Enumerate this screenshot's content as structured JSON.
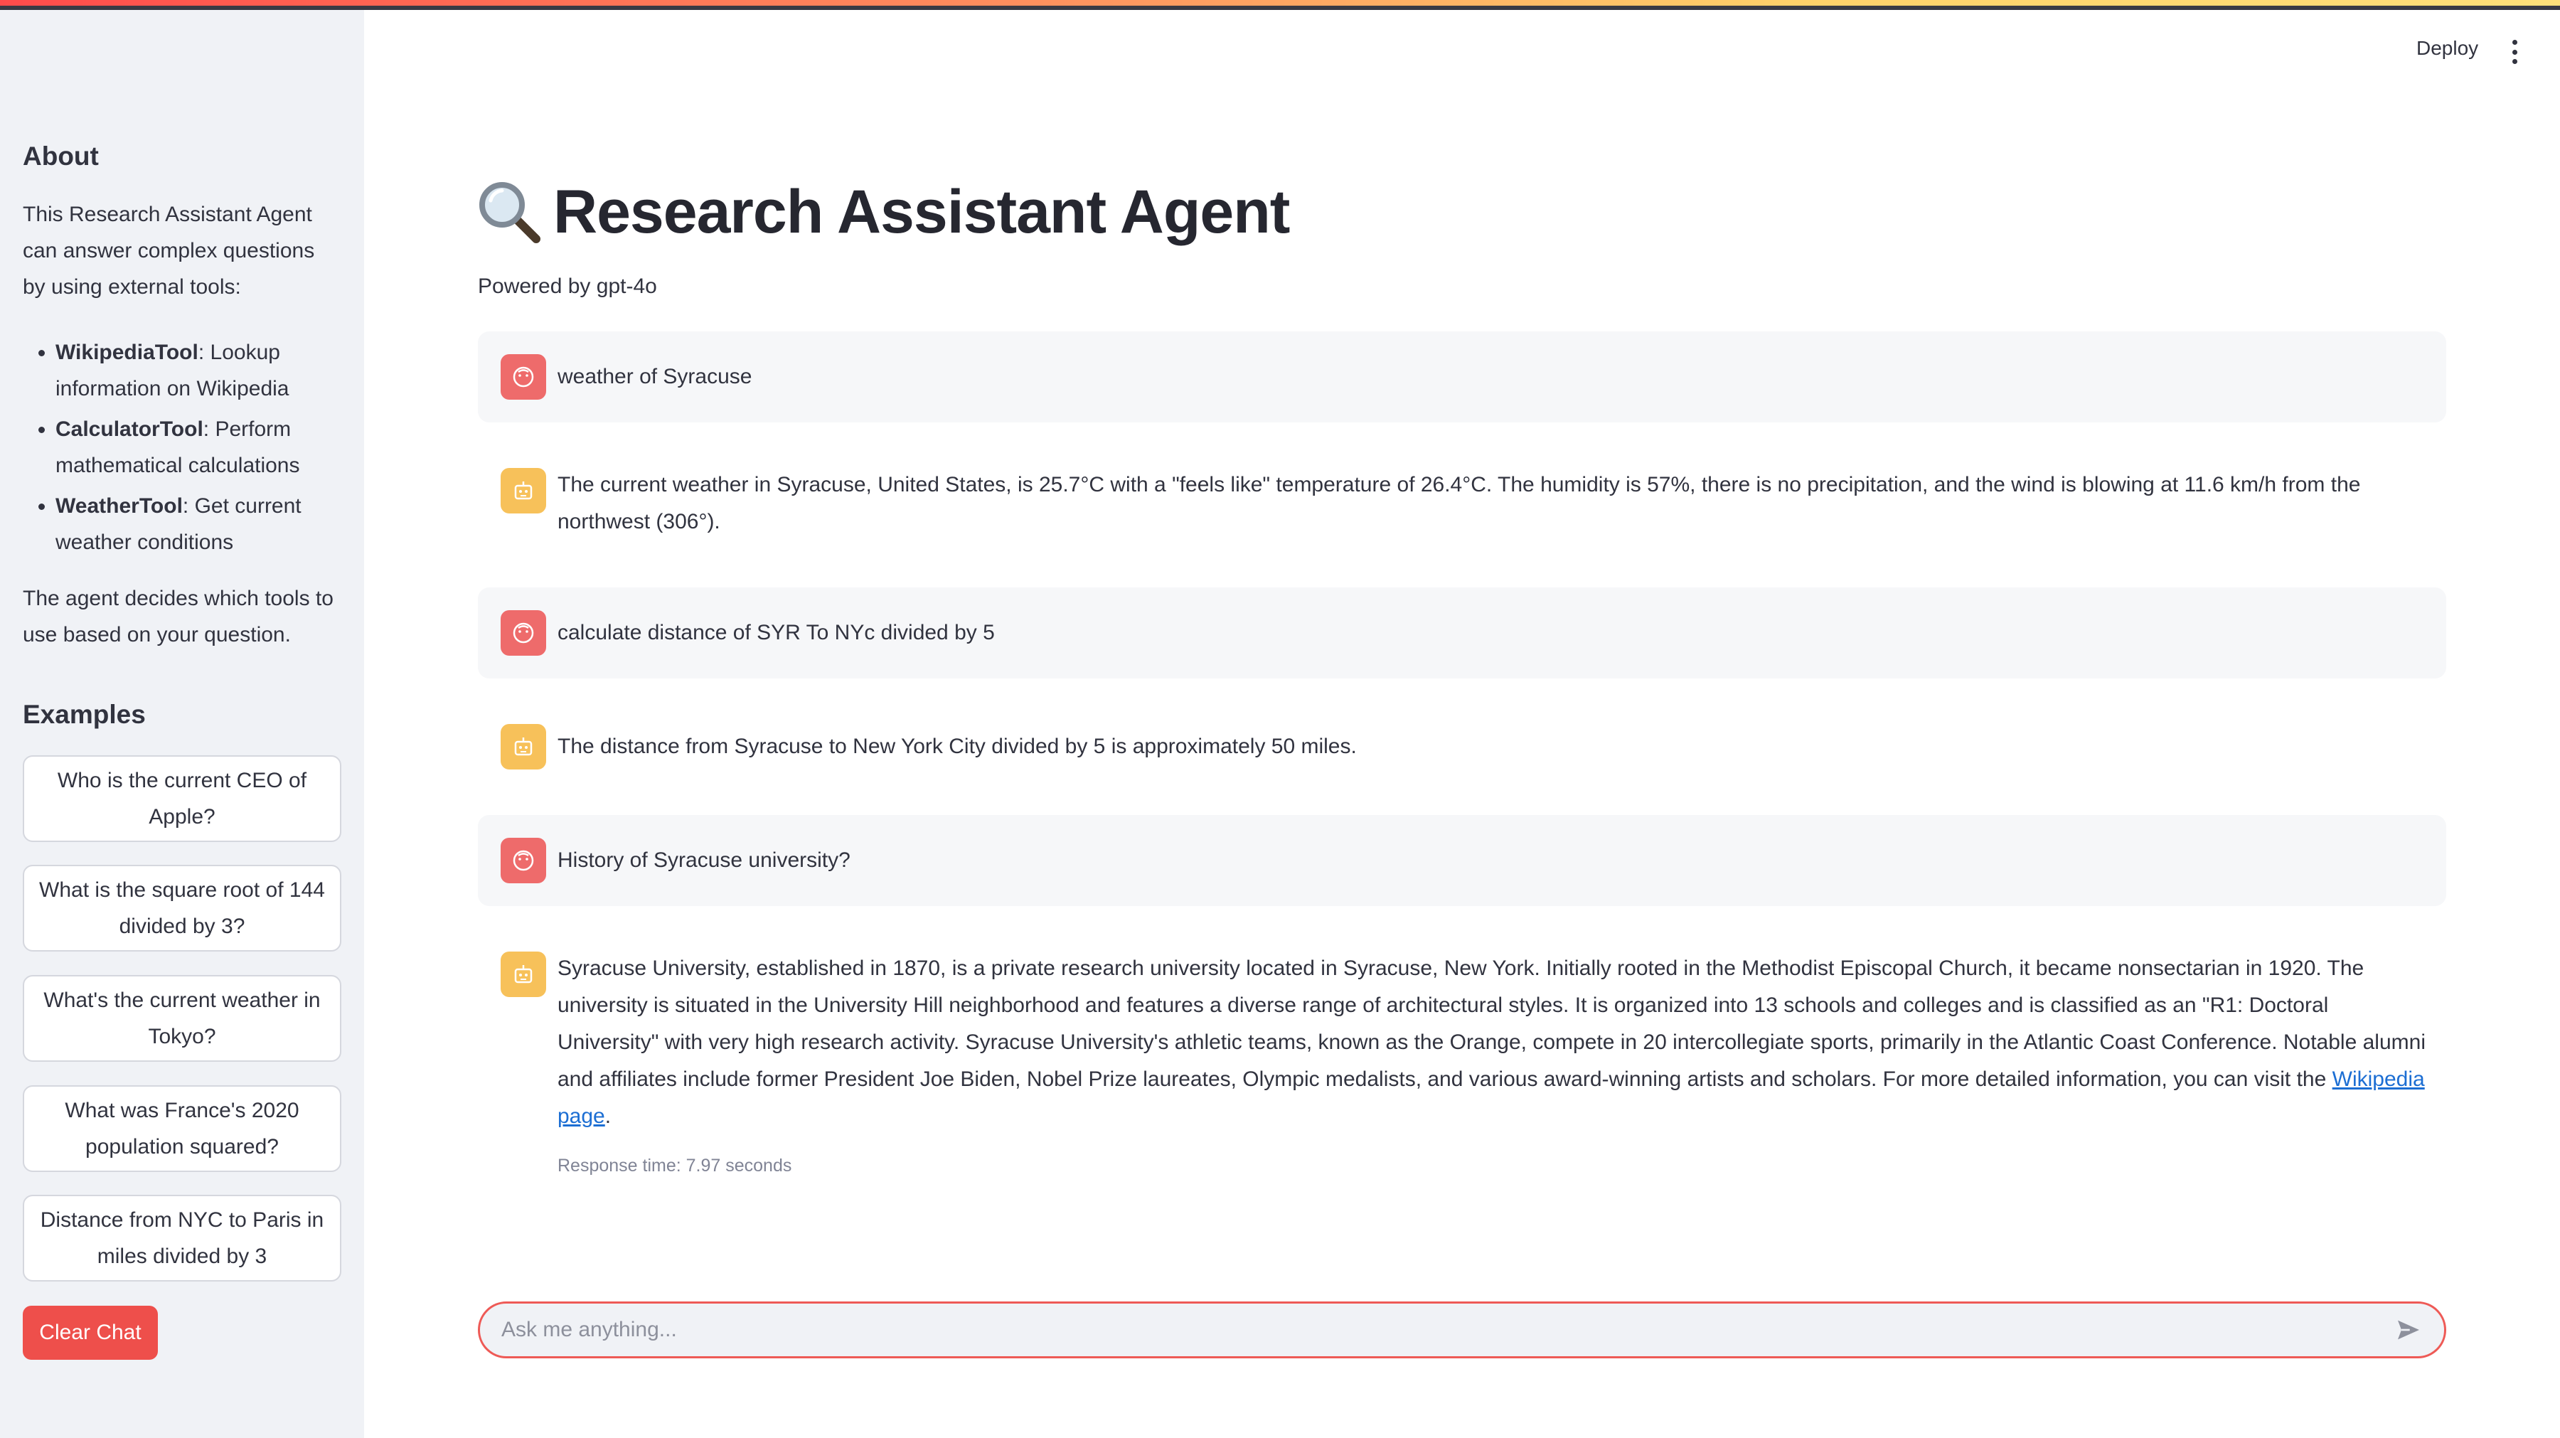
{
  "header": {
    "deploy_label": "Deploy",
    "menu_icon": "more-vertical-icon"
  },
  "sidebar": {
    "about_heading": "About",
    "about_text": "This Research Assistant Agent can answer complex questions by using external tools:",
    "tools": [
      {
        "name": "WikipediaTool",
        "desc": ": Lookup information on Wikipedia"
      },
      {
        "name": "CalculatorTool",
        "desc": ": Perform mathematical calculations"
      },
      {
        "name": "WeatherTool",
        "desc": ": Get current weather conditions"
      }
    ],
    "decide_text": "The agent decides which tools to use based on your question.",
    "examples_heading": "Examples",
    "examples": [
      "Who is the current CEO of Apple?",
      "What is the square root of 144 divided by 3?",
      "What's the current weather in Tokyo?",
      "What was France's 2020 population squared?",
      "Distance from NYC to Paris in miles divided by 3"
    ],
    "clear_label": "Clear Chat"
  },
  "main": {
    "title": "Research Assistant Agent",
    "title_icon": "magnifying-glass-icon",
    "powered_by": "Powered by gpt-4o",
    "messages": [
      {
        "role": "user",
        "text": "weather of Syracuse"
      },
      {
        "role": "assistant",
        "text": "The current weather in Syracuse, United States, is 25.7°C with a \"feels like\" temperature of 26.4°C. The humidity is 57%, there is no precipitation, and the wind is blowing at 11.6 km/h from the northwest (306°)."
      },
      {
        "role": "user",
        "text": "calculate distance of SYR To NYc divided by 5"
      },
      {
        "role": "assistant",
        "text": "The distance from Syracuse to New York City divided by 5 is approximately 50 miles."
      },
      {
        "role": "user",
        "text": "History of Syracuse university?"
      },
      {
        "role": "assistant",
        "text": "Syracuse University, established in 1870, is a private research university located in Syracuse, New York. Initially rooted in the Methodist Episcopal Church, it became nonsectarian in 1920. The university is situated in the University Hill neighborhood and features a diverse range of architectural styles. It is organized into 13 schools and colleges and is classified as an \"R1: Doctoral University\" with very high research activity. Syracuse University's athletic teams, known as the Orange, compete in 20 intercollegiate sports, primarily in the Atlantic Coast Conference. Notable alumni and affiliates include former President Joe Biden, Nobel Prize laureates, Olympic medalists, and various award-winning artists and scholars. For more detailed information, you can visit the",
        "link_text": "Wikipedia page",
        "after_link": ".",
        "response_time": "Response time: 7.97 seconds"
      }
    ]
  },
  "chat_input": {
    "placeholder": "Ask me anything...",
    "value": "",
    "send_icon": "send-icon"
  },
  "colors": {
    "user_avatar": "#ee6b6b",
    "bot_avatar": "#f7c15a",
    "accent": "#ee4f4b",
    "sidebar_bg": "#f0f2f6"
  }
}
